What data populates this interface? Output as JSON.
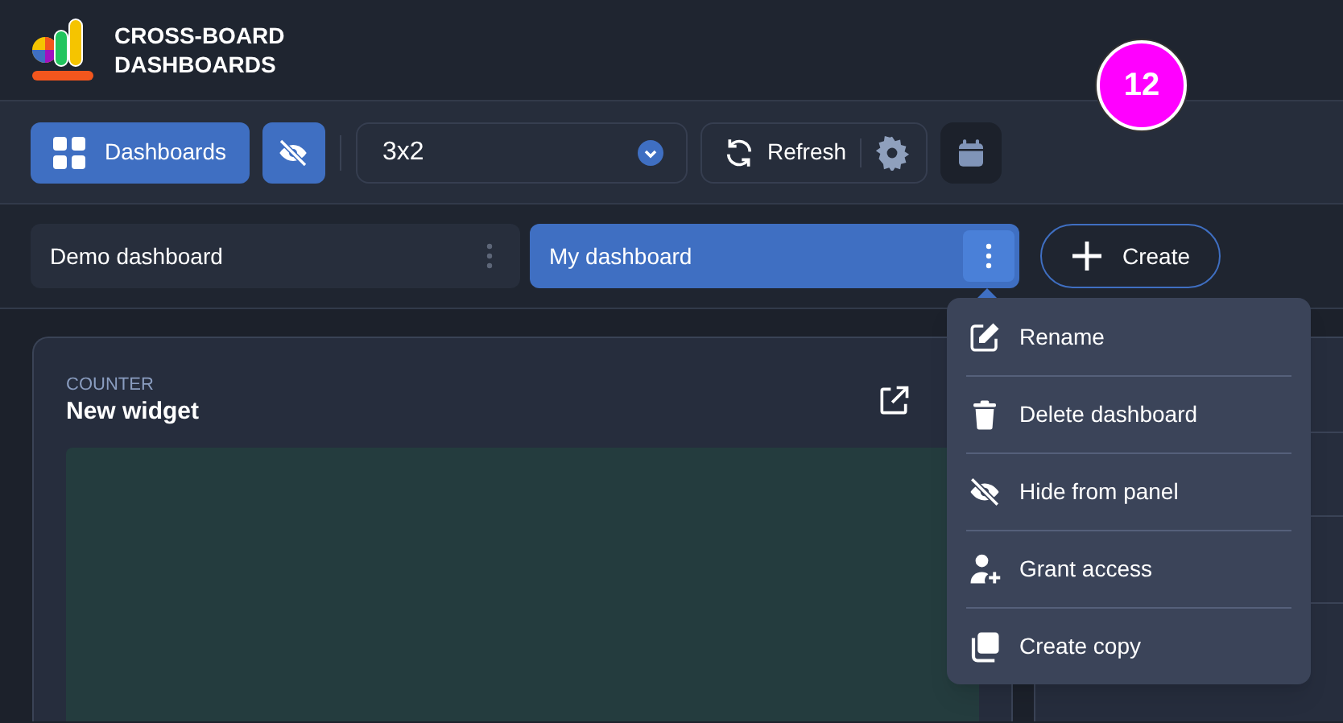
{
  "app": {
    "title_lines": [
      "CROSS-BOARD",
      "DASHBOARDS"
    ]
  },
  "badge": {
    "text": "12"
  },
  "toolbar": {
    "dashboards_button": {
      "label": "Dashboards",
      "selected": true
    },
    "hide_toggle": {
      "on": true
    },
    "layout_select": {
      "value": "3x2"
    },
    "refresh_button": {
      "label": "Refresh"
    }
  },
  "tabs": [
    {
      "label": "Demo dashboard",
      "selected": false
    },
    {
      "label": "My dashboard",
      "selected": true
    }
  ],
  "create_button": {
    "label": "Create"
  },
  "menu": {
    "items": [
      {
        "kind": "rename",
        "label": "Rename"
      },
      {
        "kind": "delete",
        "label": "Delete dashboard"
      },
      {
        "kind": "hide",
        "label": "Hide from panel"
      },
      {
        "kind": "access",
        "label": "Grant access"
      },
      {
        "kind": "copy",
        "label": "Create copy"
      }
    ]
  },
  "widget": {
    "type_label": "COUNTER",
    "title": "New widget"
  }
}
